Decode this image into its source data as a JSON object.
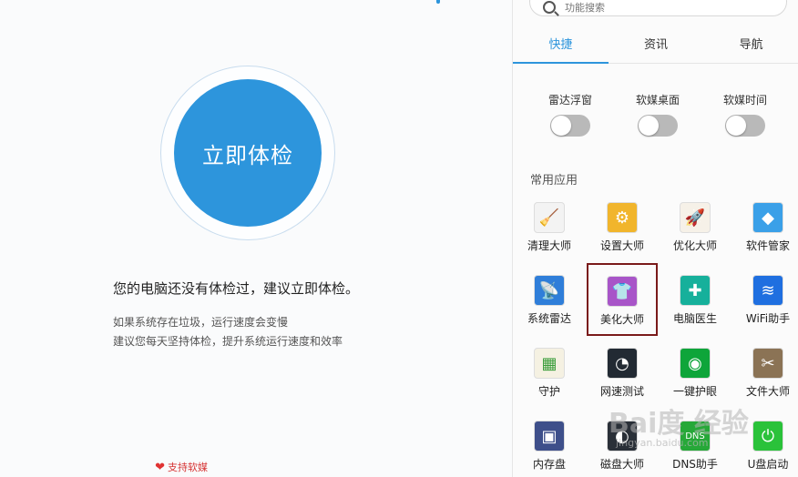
{
  "left": {
    "check_button": "立即体检",
    "main_message": "您的电脑还没有体检过，建议立即体检。",
    "sub_message_1": "如果系统存在垃圾，运行速度会变慢",
    "sub_message_2": "建议您每天坚持体检，提升系统运行速度和效率",
    "support_label": "支持软媒"
  },
  "right": {
    "search_placeholder": "功能搜索",
    "tabs": [
      {
        "label": "快捷",
        "active": true
      },
      {
        "label": "资讯",
        "active": false
      },
      {
        "label": "导航",
        "active": false
      }
    ],
    "toggles": [
      {
        "label": "雷达浮窗",
        "on": false
      },
      {
        "label": "软媒桌面",
        "on": false
      },
      {
        "label": "软媒时间",
        "on": false
      }
    ],
    "section_title": "常用应用",
    "apps": [
      {
        "label": "清理大师",
        "icon": "broom-icon",
        "color": "#f3f3f3"
      },
      {
        "label": "设置大师",
        "icon": "gear-icon",
        "color": "#f1b52c"
      },
      {
        "label": "优化大师",
        "icon": "rocket-icon",
        "color": "#f6f1e8"
      },
      {
        "label": "软件管家",
        "icon": "software-manager-icon",
        "color": "#3aa0e8"
      },
      {
        "label": "系统雷达",
        "icon": "radar-icon",
        "color": "#2f7ed9"
      },
      {
        "label": "美化大师",
        "icon": "tshirt-icon",
        "color": "#a855c8"
      },
      {
        "label": "电脑医生",
        "icon": "medical-kit-icon",
        "color": "#16b09b"
      },
      {
        "label": "WiFi助手",
        "icon": "wifi-icon",
        "color": "#1f6fe0"
      },
      {
        "label": "守护",
        "icon": "shield-icon",
        "color": "#f5f1e2"
      },
      {
        "label": "网速测试",
        "icon": "speedometer-icon",
        "color": "#222a33"
      },
      {
        "label": "一键护眼",
        "icon": "eye-icon",
        "color": "#0ea53a"
      },
      {
        "label": "文件大师",
        "icon": "file-icon",
        "color": "#8b7355"
      },
      {
        "label": "内存盘",
        "icon": "memory-chip-icon",
        "color": "#3e4f8a"
      },
      {
        "label": "磁盘大师",
        "icon": "disk-icon",
        "color": "#2a3038"
      },
      {
        "label": "DNS助手",
        "icon": "dns-icon",
        "color": "#26a838"
      },
      {
        "label": "U盘启动",
        "icon": "usb-icon",
        "color": "#2ac23a"
      }
    ]
  },
  "watermark": {
    "text": "Bai度 经验",
    "sub": "jingyan.baidu.com"
  }
}
